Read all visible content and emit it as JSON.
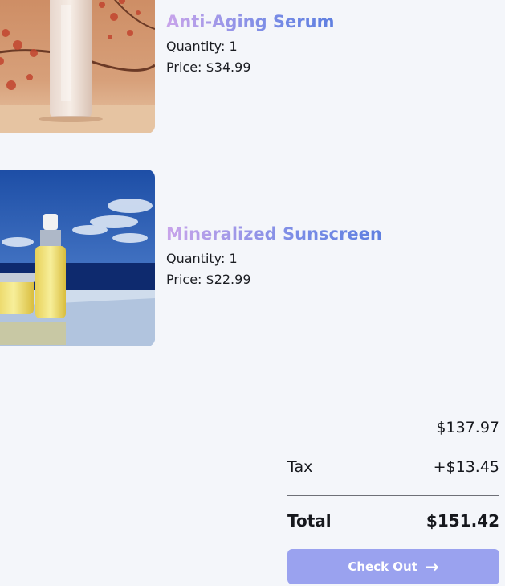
{
  "cart": {
    "items": [
      {
        "name": "Anti-Aging Serum",
        "quantity": "Quantity: 1",
        "price": "Price: $34.99"
      },
      {
        "name": "Mineralized Sunscreen",
        "quantity": "Quantity: 1",
        "price": "Price: $22.99"
      }
    ]
  },
  "summary": {
    "subtotal_value": "$137.97",
    "tax_label": "Tax",
    "tax_value": "+$13.45",
    "total_label": "Total",
    "total_value": "$151.42"
  },
  "checkout": {
    "label": "Check Out",
    "icon": "arrow-right-icon"
  },
  "colors": {
    "name_gradient_start": "#c9a4ea",
    "name_gradient_end": "#5f7fe0",
    "checkout_button": "#9aa2ef",
    "page_background": "#f4f6fa"
  }
}
